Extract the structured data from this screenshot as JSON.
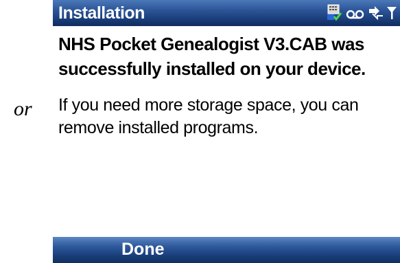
{
  "side_note": "or",
  "title_bar": {
    "title": "Installation",
    "icons": [
      "phone-icon",
      "voicemail-icon",
      "connectivity-icon",
      "signal-icon"
    ]
  },
  "content": {
    "heading": "NHS Pocket Genealogist V3.CAB was successfully installed on your device.",
    "message": "If you need more storage space, you can remove installed programs."
  },
  "softkeys": {
    "left_label": "Done"
  },
  "colors": {
    "bar_dark": "#0f2b5e",
    "bar_light": "#4a78b8",
    "text": "#000000",
    "background": "#ffffff"
  }
}
